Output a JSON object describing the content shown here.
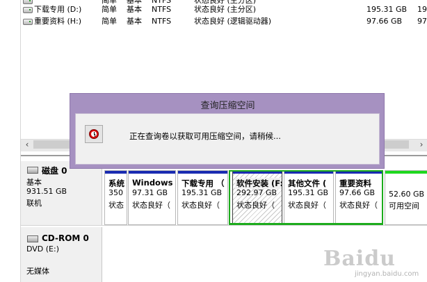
{
  "volume_list": [
    {
      "name": "",
      "layout": "简单",
      "type": "基本",
      "fs": "NTFS",
      "status": "状态良好 (主分区)",
      "capacity": "",
      "free": ""
    },
    {
      "name": "下载专用 (D:)",
      "layout": "简单",
      "type": "基本",
      "fs": "NTFS",
      "status": "状态良好 (主分区)",
      "capacity": "195.31 GB",
      "free": "195"
    },
    {
      "name": "重要资料 (H:)",
      "layout": "简单",
      "type": "基本",
      "fs": "NTFS",
      "status": "状态良好 (逻辑驱动器)",
      "capacity": "97.66 GB",
      "free": "97.6"
    }
  ],
  "scrollbar": {
    "left_arrow": "‹",
    "right_arrow": "›"
  },
  "disk0": {
    "title": "磁盘 0",
    "type": "基本",
    "size": "931.51 GB",
    "state": "联机",
    "partitions": [
      {
        "name": "系统",
        "size": "350",
        "state": "状态"
      },
      {
        "name": "Windows",
        "size": "97.31 GB",
        "state": "状态良好（"
      },
      {
        "name": "下载专用 （",
        "size": "195.31 GB",
        "state": "状态良好（"
      },
      {
        "name": "软件安装 (F:)",
        "size": "292.97 GB",
        "state": "状态良好（"
      },
      {
        "name": "其他文件 (",
        "size": "195.31 GB",
        "state": "状态良好（"
      },
      {
        "name": "重要资料",
        "size": "97.66 GB",
        "state": "状态良好（"
      },
      {
        "name": "",
        "size": "52.60 GB",
        "state": "可用空间"
      }
    ]
  },
  "cdrom0": {
    "title": "CD-ROM 0",
    "type": "DVD (E:)",
    "state": "无媒体"
  },
  "dialog": {
    "title": "查询压缩空间",
    "message": "正在查询卷以获取可用压缩空间，请稍候..."
  },
  "watermark": {
    "brand": "Baidu",
    "url": "jingyan.baidu.com"
  },
  "colors": {
    "dialog_frame": "#a691c1",
    "primary_partition": "#1a2bb1",
    "free_space": "#1fd81f",
    "selection": "#1cab1c"
  }
}
